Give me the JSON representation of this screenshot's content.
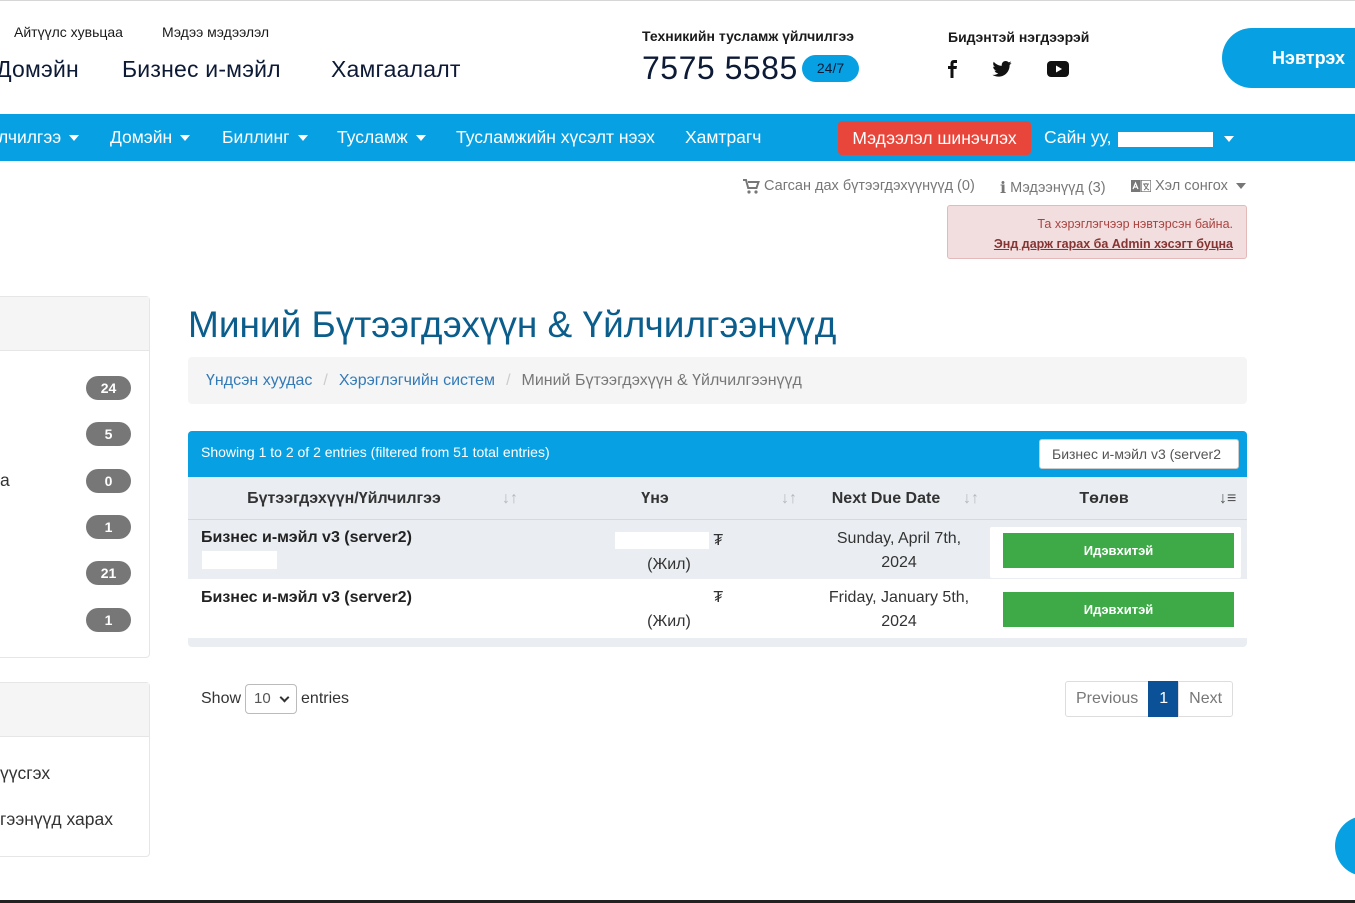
{
  "header": {
    "small_links": [
      "Айтүүлс хувьцаа",
      "Мэдээ мэдээлэл"
    ],
    "main_links": [
      "Домэйн",
      "Бизнес и-мэйл",
      "Хамгаалалт"
    ],
    "support_label": "Техникийн тусламж үйлчилгээ",
    "support_phone": "7575 5585",
    "support_badge": "24/7",
    "contact_label": "Бидэнтэй нэгдээрэй",
    "social_icons": [
      "facebook-icon",
      "twitter-icon",
      "youtube-icon"
    ],
    "login_label": "Нэвтрэх"
  },
  "nav": {
    "items": [
      "лчилгээ",
      "Домэйн",
      "Биллинг",
      "Тусламж",
      "Тусламжийн хүсэлт нээх",
      "Хамтрагч"
    ],
    "update_label": "Мэдээлэл шинэчлэх",
    "greeting": "Сайн уу,"
  },
  "utility": {
    "cart": "Сагсан дах бүтээгдэхүүнүүд (0)",
    "notices": "Мэдээнүүд (3)",
    "language": "Хэл сонгох"
  },
  "alert": {
    "line1": "Та хэрэглэгчээр нэвтэрсэн байна.",
    "link": "Энд дарж гарах ба Admin хэсэгт буцна"
  },
  "sidebar": {
    "badges": [
      "24",
      "5",
      "0",
      "1",
      "21",
      "1"
    ],
    "partial_label": "а",
    "second_items": [
      "үүсгэх",
      "гээнүүд харах"
    ]
  },
  "main": {
    "title": "Миний Бүтээгдэхүүн & Үйлчилгээнүүд",
    "breadcrumb": [
      "Үндсэн хуудас",
      "Хэрэглэгчийн систем",
      "Миний Бүтээгдэхүүн & Үйлчилгээнүүд"
    ],
    "table": {
      "info": "Showing 1 to 2 of 2 entries (filtered from 51 total entries)",
      "search_value": "Бизнес и-мэйл v3 (server2",
      "headers": [
        "Бүтээгдэхүүн/Үйлчилгээ",
        "Үнэ",
        "Next Due Date",
        "Төлөв"
      ],
      "rows": [
        {
          "product": "Бизнес и-мэйл v3 (server2)",
          "currency": "₮",
          "cycle": "(Жил)",
          "due_line1": "Sunday, April 7th,",
          "due_line2": "2024",
          "status": "Идэвхитэй"
        },
        {
          "product": "Бизнес и-мэйл v3 (server2)",
          "currency": "₮",
          "cycle": "(Жил)",
          "due_line1": "Friday, January 5th,",
          "due_line2": "2024",
          "status": "Идэвхитэй"
        }
      ]
    },
    "show_label": "Show",
    "entries_value": "10",
    "entries_label": "entries",
    "pager": {
      "previous": "Previous",
      "current": "1",
      "next": "Next"
    }
  },
  "colors": {
    "accent": "#07a1e3",
    "danger": "#e8463a",
    "success": "#3daa47",
    "title": "#0b5d8c"
  }
}
